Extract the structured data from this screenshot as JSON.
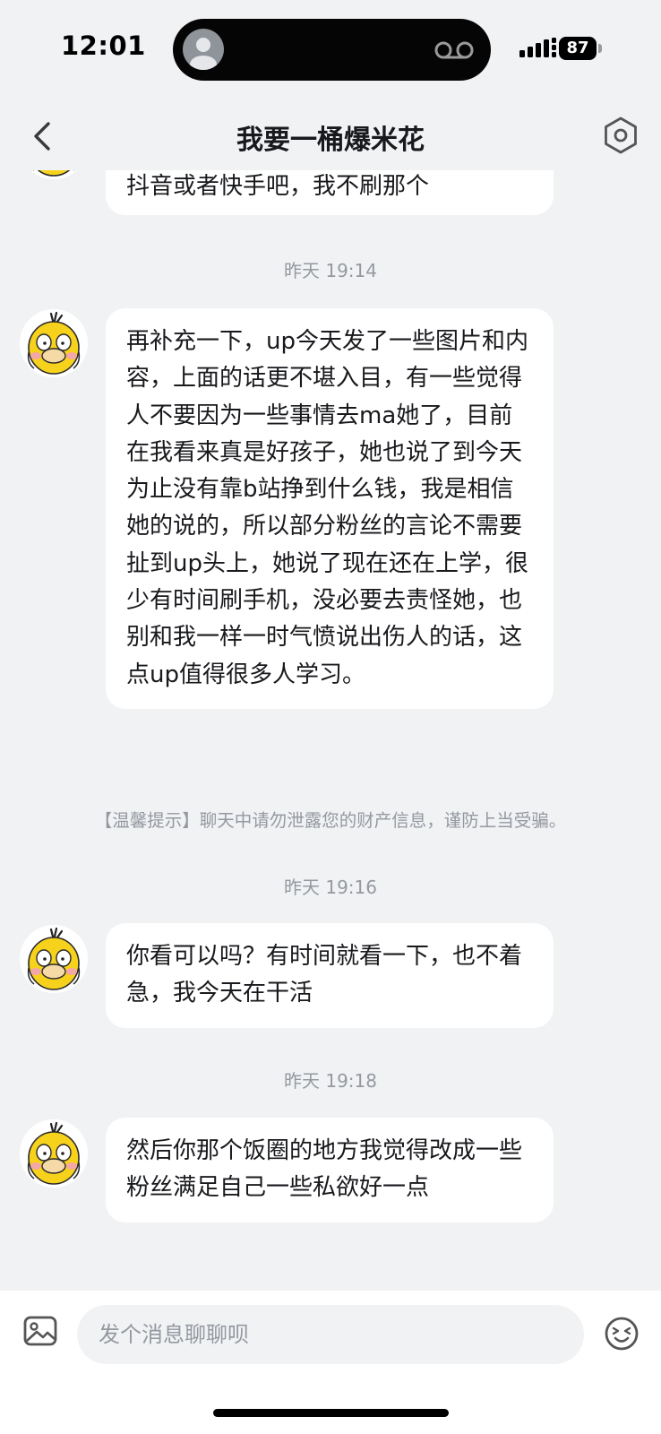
{
  "status_bar": {
    "time": "12:01",
    "battery": "87"
  },
  "header": {
    "title": "我要一桶爆米花"
  },
  "messages": [
    {
      "text": "抖音或者快手吧，我不刷那个"
    },
    {
      "time": "昨天 19:14",
      "text": "再补充一下，up今天发了一些图片和内容，上面的话更不堪入目，有一些觉得人不要因为一些事情去ma她了，目前在我看来真是好孩子，她也说了到今天为止没有靠b站挣到什么钱，我是相信她的说的，所以部分粉丝的言论不需要扯到up头上，她说了现在还在上学，很少有时间刷手机，没必要去责怪她，也别和我一样一时气愤说出伤人的话，这点up值得很多人学习。"
    },
    {
      "time": "昨天 19:16",
      "text": "你看可以吗？有时间就看一下，也不着急，我今天在干活"
    },
    {
      "time": "昨天 19:18",
      "text": "然后你那个饭圈的地方我觉得改成一些粉丝满足自己一些私欲好一点"
    }
  ],
  "notice": "【温馨提示】聊天中请勿泄露您的财产信息，谨防上当受骗。",
  "composer": {
    "placeholder": "发个消息聊聊呗"
  },
  "colors": {
    "background": "#f1f2f4",
    "bubble": "#ffffff",
    "secondary_text": "#9499a0",
    "avatar_yellow": "#f7d21c"
  },
  "icons": {
    "back": "chevron-left-icon",
    "settings": "hexagon-settings-icon",
    "image": "image-icon",
    "emoji": "emoji-face-icon"
  }
}
